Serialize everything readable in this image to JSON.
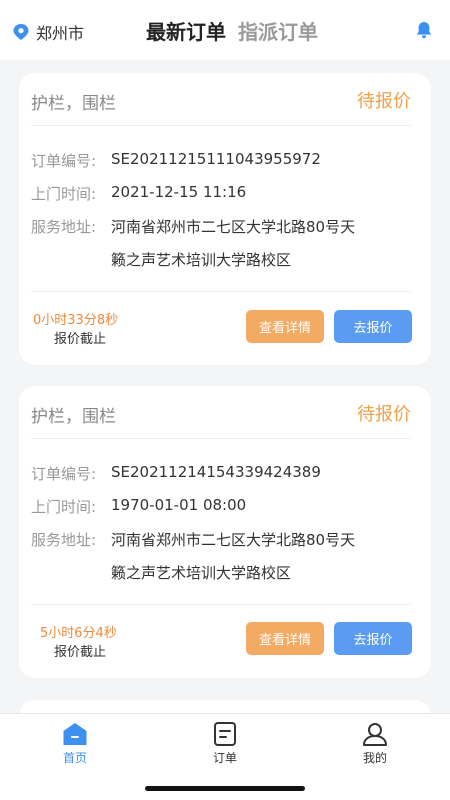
{
  "header": {
    "location": "郑州市",
    "tabs": [
      {
        "label": "最新订单",
        "active": true
      },
      {
        "label": "指派订单",
        "active": false
      }
    ],
    "icons": {
      "location": "location-pin-icon",
      "notification": "bell-icon"
    }
  },
  "labels": {
    "order_no": "订单编号:",
    "visit_time": "上门时间:",
    "address": "服务地址:",
    "deadline": "报价截止",
    "view_detail": "查看详情",
    "go_quote": "去报价"
  },
  "orders": [
    {
      "title": "护栏，围栏",
      "status": "待报价",
      "order_no": "SE20211215111043955972",
      "visit_time": "2021-12-15 11:16",
      "address_line1": "河南省郑州市二七区大学北路80号天",
      "address_line2": "籁之声艺术培训大学路校区",
      "countdown": "0小时33分8秒"
    },
    {
      "title": "护栏，围栏",
      "status": "待报价",
      "order_no": "SE20211214154339424389",
      "visit_time": "1970-01-01 08:00",
      "address_line1": "河南省郑州市二七区大学北路80号天",
      "address_line2": "籁之声艺术培训大学路校区",
      "countdown": "5小时6分4秒"
    }
  ],
  "bottom_nav": [
    {
      "label": "首页",
      "icon": "home-icon",
      "active": true
    },
    {
      "label": "订单",
      "icon": "order-list-icon",
      "active": false
    },
    {
      "label": "我的",
      "icon": "user-profile-icon",
      "active": false
    }
  ],
  "colors": {
    "accent_blue": "#3d8ff0",
    "status_orange": "#f0a04a",
    "detail_button": "#f3aa62",
    "quote_button": "#5b9cf2"
  }
}
